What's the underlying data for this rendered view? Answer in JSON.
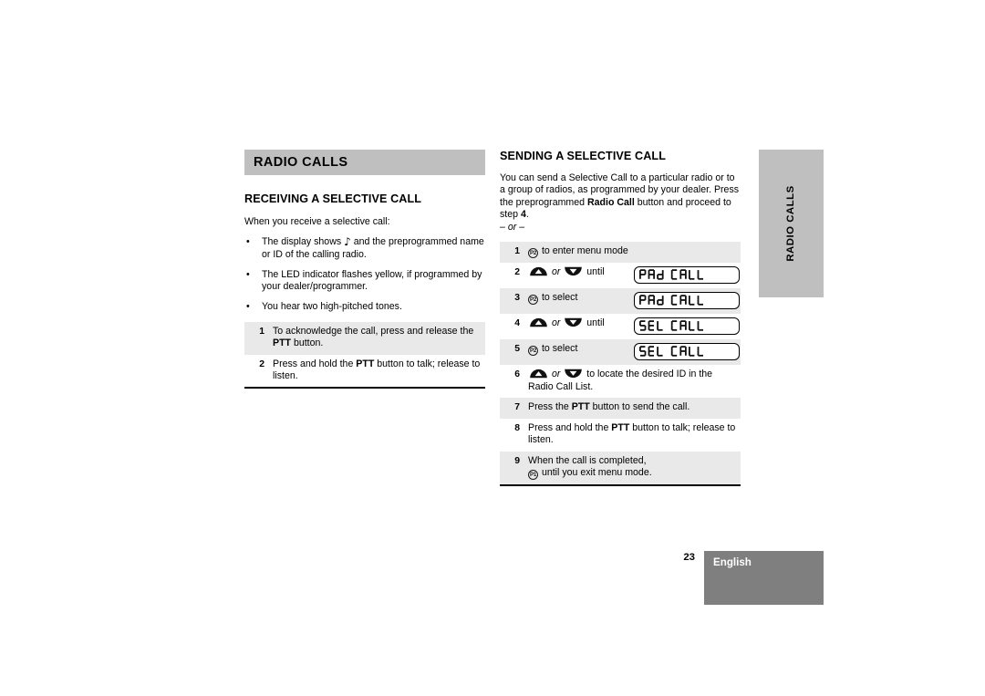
{
  "document": {
    "page_number": "23",
    "language": "English",
    "side_tab_label": "RADIO CALLS",
    "colors": {
      "chapter_bar": "#bfbfbf",
      "side_tab": "#bfbfbf",
      "row_shade": "#e9e9e9",
      "footer_box": "#7f7f7f",
      "text": "#000000"
    }
  },
  "left_column": {
    "chapter_title": "RADIO CALLS",
    "section_title": "RECEIVING A SELECTIVE CALL",
    "intro": "When you receive a selective call:",
    "bullets": [
      {
        "mark": "•",
        "pre": "The display shows ",
        "icon": "music-note-icon",
        "post": " and the preprogrammed name or ID of the calling radio."
      },
      {
        "mark": "•",
        "pre": "The LED indicator flashes yellow, if programmed by your dealer/programmer.",
        "icon": "",
        "post": ""
      },
      {
        "mark": "•",
        "pre": "You hear two high-pitched tones.",
        "icon": "",
        "post": ""
      }
    ],
    "steps": [
      {
        "num": "1",
        "shaded": true,
        "parts": [
          {
            "t": "text",
            "v": "To acknowledge the call, press and release the "
          },
          {
            "t": "bold",
            "v": "PTT"
          },
          {
            "t": "text",
            "v": " button."
          }
        ]
      },
      {
        "num": "2",
        "shaded": false,
        "parts": [
          {
            "t": "text",
            "v": "Press and hold the "
          },
          {
            "t": "bold",
            "v": "PTT"
          },
          {
            "t": "text",
            "v": " button to talk; release to listen."
          }
        ]
      }
    ]
  },
  "right_column": {
    "section_title": "SENDING A SELECTIVE CALL",
    "paragraph_parts": [
      {
        "t": "text",
        "v": "You can send a Selective Call to a particular radio or to a group of radios, as programmed by your dealer. Press the preprogrammed "
      },
      {
        "t": "bold",
        "v": "Radio Call"
      },
      {
        "t": "text",
        "v": " button and proceed to step "
      },
      {
        "t": "bold",
        "v": "4"
      },
      {
        "t": "text",
        "v": "."
      }
    ],
    "or_separator": "– or –",
    "steps": [
      {
        "num": "1",
        "shaded": true,
        "lcd": "",
        "parts": [
          {
            "t": "icon",
            "v": "p2-button-icon",
            "label": "P2"
          },
          {
            "t": "text",
            "v": " to enter menu mode"
          }
        ]
      },
      {
        "num": "2",
        "shaded": false,
        "lcd": "RAD CALL",
        "parts": [
          {
            "t": "icon",
            "v": "up-arrow-button-icon",
            "label": "▲"
          },
          {
            "t": "text",
            "v": " "
          },
          {
            "t": "italic",
            "v": "or"
          },
          {
            "t": "text",
            "v": " "
          },
          {
            "t": "icon",
            "v": "down-arrow-button-icon",
            "label": "▼"
          },
          {
            "t": "text",
            "v": " until"
          }
        ]
      },
      {
        "num": "3",
        "shaded": true,
        "lcd": "RAD CALL",
        "parts": [
          {
            "t": "icon",
            "v": "p2-button-icon",
            "label": "P2"
          },
          {
            "t": "text",
            "v": " to select"
          }
        ]
      },
      {
        "num": "4",
        "shaded": false,
        "lcd": "SEL CALL",
        "parts": [
          {
            "t": "icon",
            "v": "up-arrow-button-icon",
            "label": "▲"
          },
          {
            "t": "text",
            "v": " "
          },
          {
            "t": "italic",
            "v": "or"
          },
          {
            "t": "text",
            "v": " "
          },
          {
            "t": "icon",
            "v": "down-arrow-button-icon",
            "label": "▼"
          },
          {
            "t": "text",
            "v": " until"
          }
        ]
      },
      {
        "num": "5",
        "shaded": true,
        "lcd": "SEL CALL",
        "parts": [
          {
            "t": "icon",
            "v": "p2-button-icon",
            "label": "P2"
          },
          {
            "t": "text",
            "v": " to select"
          }
        ]
      },
      {
        "num": "6",
        "shaded": false,
        "lcd": "",
        "parts": [
          {
            "t": "icon",
            "v": "up-arrow-button-icon",
            "label": "▲"
          },
          {
            "t": "text",
            "v": " "
          },
          {
            "t": "italic",
            "v": "or"
          },
          {
            "t": "text",
            "v": " "
          },
          {
            "t": "icon",
            "v": "down-arrow-button-icon",
            "label": "▼"
          },
          {
            "t": "text",
            "v": " to locate the desired ID in the Radio Call List."
          }
        ]
      },
      {
        "num": "7",
        "shaded": true,
        "lcd": "",
        "parts": [
          {
            "t": "text",
            "v": "Press the "
          },
          {
            "t": "bold",
            "v": "PTT"
          },
          {
            "t": "text",
            "v": " button to send the call."
          }
        ]
      },
      {
        "num": "8",
        "shaded": false,
        "lcd": "",
        "parts": [
          {
            "t": "text",
            "v": "Press and hold the "
          },
          {
            "t": "bold",
            "v": "PTT"
          },
          {
            "t": "text",
            "v": " button to talk; release to listen."
          }
        ]
      },
      {
        "num": "9",
        "shaded": true,
        "lcd": "",
        "parts": [
          {
            "t": "text",
            "v": "When the call is completed,"
          },
          {
            "t": "br",
            "v": ""
          },
          {
            "t": "icon",
            "v": "p1-button-icon",
            "label": "P1"
          },
          {
            "t": "text",
            "v": " until you exit menu mode."
          }
        ]
      }
    ]
  }
}
